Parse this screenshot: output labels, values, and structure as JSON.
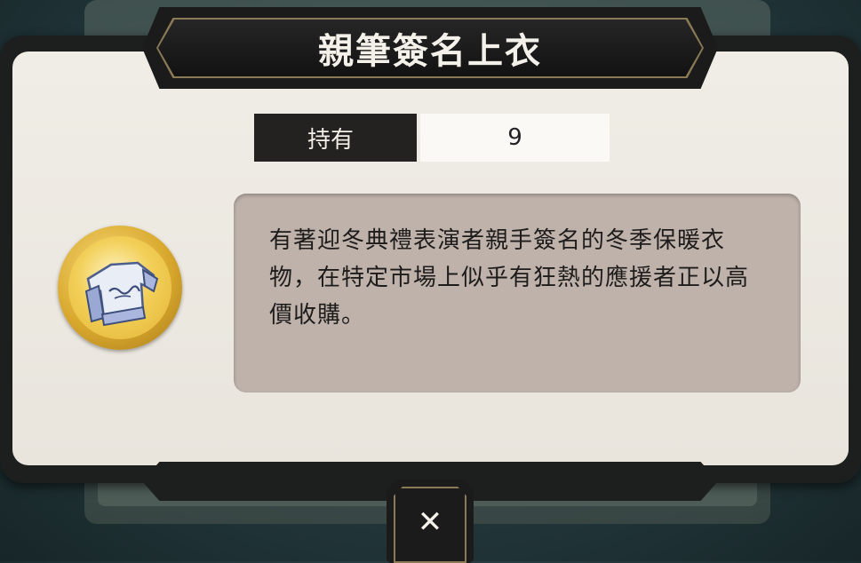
{
  "dialog": {
    "title": "親筆簽名上衣",
    "owned_label": "持有",
    "owned_value": "9",
    "description": "有著迎冬典禮表演者親手簽名的冬季保暖衣物，在特定市場上似乎有狂熱的應援者正以高價收購。",
    "item_icon": "signed-sweater-icon",
    "close_icon": "close-icon",
    "close_glyph": "✕"
  },
  "colors": {
    "frame": "#1d1f1f",
    "panel": "#ece9e2",
    "gold_trim": "#8a7a55",
    "description_bg": "#beb2ab",
    "icon_gold": "#e3b434"
  }
}
